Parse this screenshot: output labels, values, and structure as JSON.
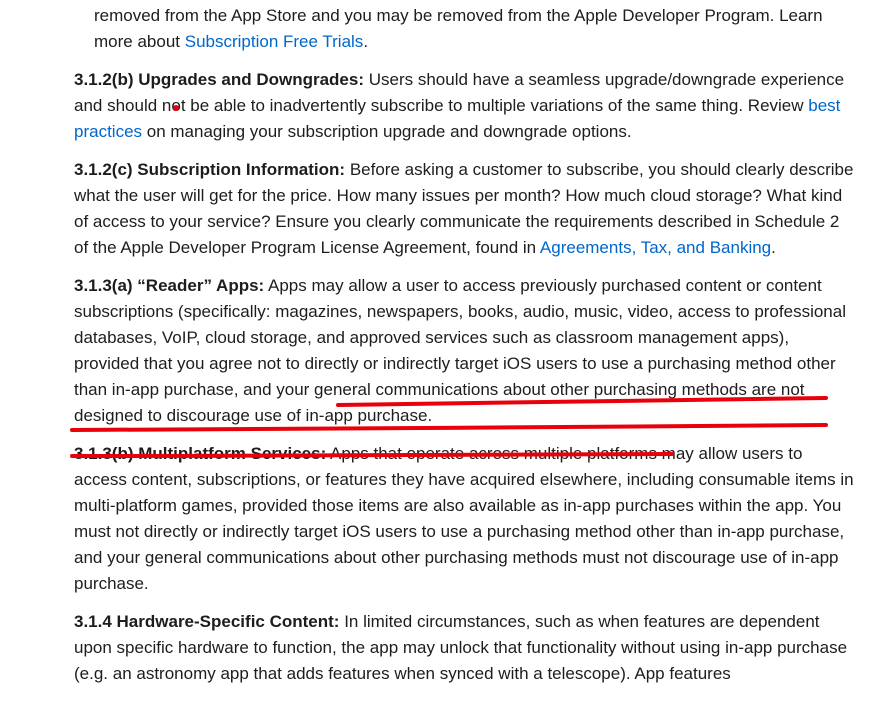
{
  "intro": {
    "text": "removed from the App Store and you may be removed from the Apple Developer Program. Learn more about ",
    "link": "Subscription Free Trials",
    "end": "."
  },
  "s312b": {
    "heading": "3.1.2(b) Upgrades and Downgrades:",
    "text1": " Users should have a seamless upgrade/downgrade experience and should not be able to inadvertently subscribe to multiple variations of the same thing. Review ",
    "link": "best practices",
    "text2": " on managing your subscription upgrade and downgrade options."
  },
  "s312c": {
    "heading": "3.1.2(c) Subscription Information:",
    "text1": " Before asking a customer to subscribe, you should clearly describe what the user will get for the price. How many issues per month? How much cloud storage? What kind of access to your service? Ensure you clearly communicate the requirements described in Schedule 2 of the Apple Developer Program License Agreement, found in ",
    "link": "Agreements, Tax, and Banking",
    "end": "."
  },
  "s313a": {
    "heading": "3.1.3(a) “Reader” Apps:",
    "text1": " Apps may allow a user to access previously purchased content or content subscriptions (specifically: magazines, newspapers, books, audio, music, video, access to professional databases, VoIP, cloud storage, and approved services such as classroom management apps), provided that ",
    "text2": "you agree not to directly or indirectly target iOS users to use a purchasing method other than in-app purchase, and your general communications about other purchasing methods are not designed to discourage use of in-app purchase."
  },
  "s313b": {
    "heading": "3.1.3(b) Multiplatform Services:",
    "text1": " Apps that operate across multiple platforms may allow users to access content, subscriptions, or features they have acquired elsewhere, including consumable items in multi-platform games, provided those items are also available as in-app purchases within the app. You must not directly or indirectly target iOS users to use a purchasing method other than in-app purchase, and your general communications about other purchasing methods must not discourage use of in-app purchase."
  },
  "s314": {
    "heading": "3.1.4 Hardware-Specific Content:",
    "text1": " In limited circumstances, such as when features are dependent upon specific hardware to function, the app may unlock that functionality without using in-app purchase (e.g. an astronomy app that adds features when synced with a telescope). App features"
  },
  "colors": {
    "link": "#0066cc",
    "annotation": "#e8000b",
    "text": "#1d1d1f"
  }
}
